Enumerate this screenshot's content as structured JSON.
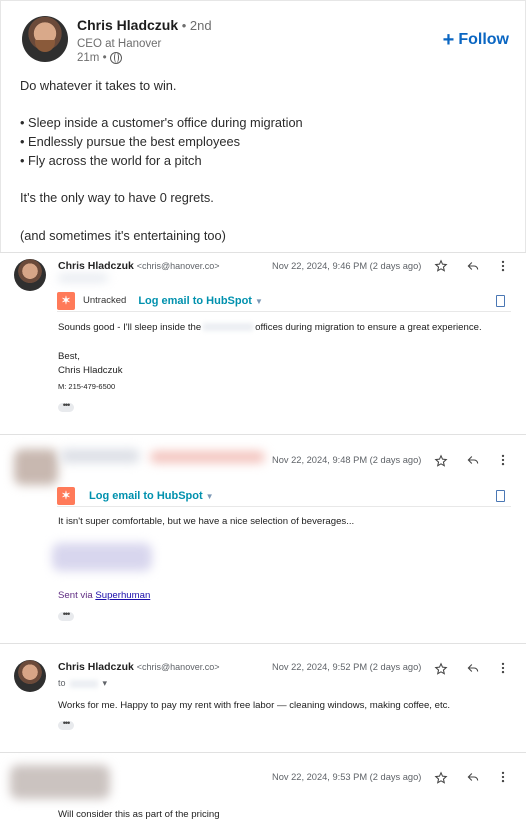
{
  "post": {
    "author_name": "Chris Hladczuk",
    "degree": " • 2nd",
    "headline": "CEO at Hanover",
    "time": "21m •",
    "follow_label": "Follow",
    "body": "Do whatever it takes to win.\n\n• Sleep inside a customer's office during migration\n• Endlessly pursue the best employees\n• Fly across the world for a pitch\n\nIt's the only way to have 0 regrets.\n\n(and sometimes it's entertaining too)"
  },
  "emails": [
    {
      "sender_name": "Chris Hladczuk",
      "sender_email": "<chris@hanover.co>",
      "date": "Nov 22, 2024, 9:46 PM (2 days ago)",
      "hubspot_status": "Untracked",
      "hubspot_log": "Log email to HubSpot",
      "body_before": "Sounds good - I'll sleep inside the",
      "body_after": "offices during migration to ensure a great experience.",
      "sig_closing": "Best,",
      "sig_name": "Chris Hladczuk",
      "sig_phone": "M: 215-479-6500"
    },
    {
      "date": "Nov 22, 2024, 9:48 PM (2 days ago)",
      "hubspot_log": "Log email to HubSpot",
      "body": "It isn't super comfortable, but we have a nice selection of beverages...",
      "sent_via_prefix": "Sent via ",
      "sent_via_link": "Superhuman"
    },
    {
      "sender_name": "Chris Hladczuk",
      "sender_email": "<chris@hanover.co>",
      "date": "Nov 22, 2024, 9:52 PM (2 days ago)",
      "to_prefix": "to",
      "body": "Works for me. Happy to pay my rent with free labor — cleaning windows, making coffee, etc."
    },
    {
      "date": "Nov 22, 2024, 9:53 PM (2 days ago)",
      "body": "Will consider this as part of the pricing"
    }
  ],
  "colors": {
    "linkedin_blue": "#0a66c2",
    "hubspot_orange": "#ff7a59",
    "hubspot_teal": "#0091ae"
  }
}
